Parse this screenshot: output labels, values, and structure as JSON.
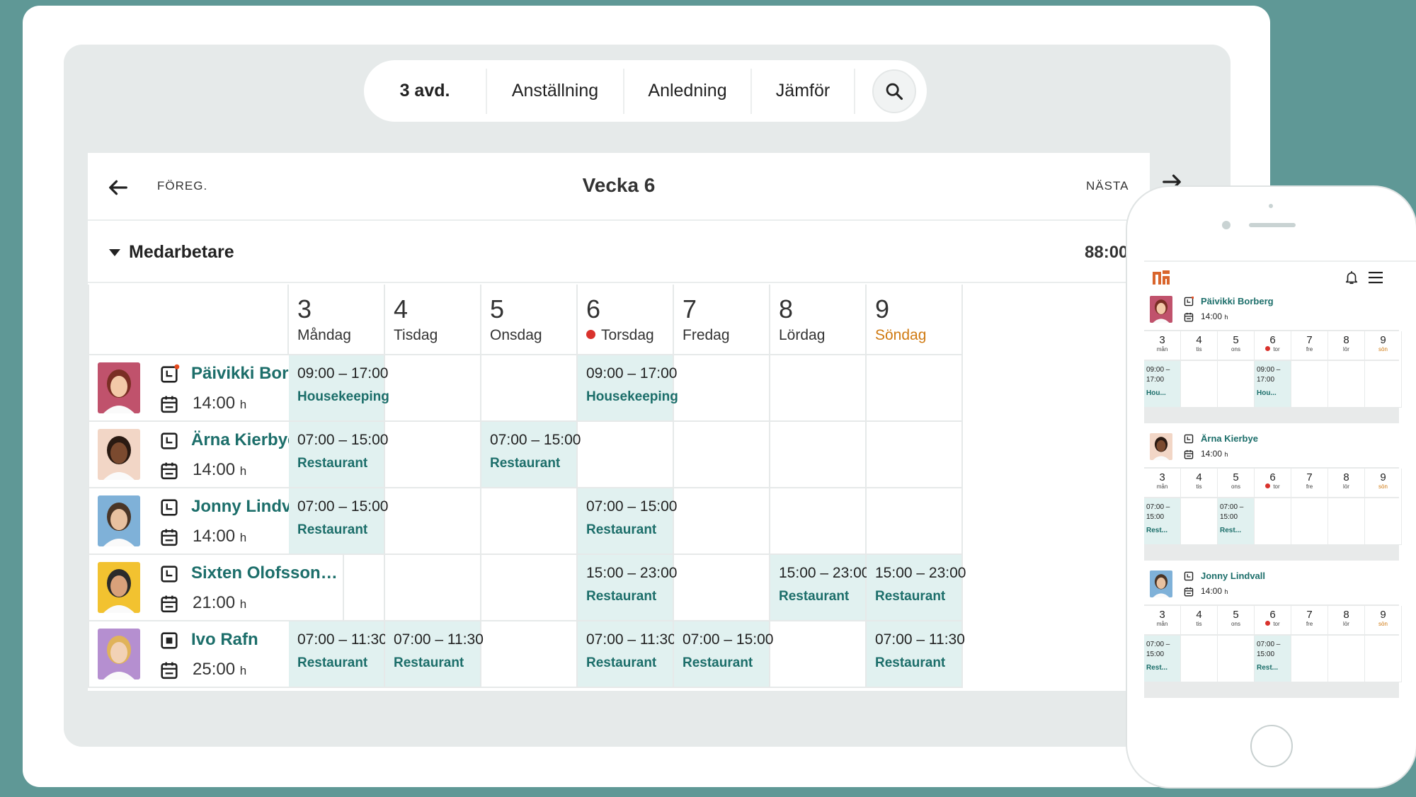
{
  "filters": [
    {
      "label": "3 avd."
    },
    {
      "label": "Anställning"
    },
    {
      "label": "Anledning"
    },
    {
      "label": "Jämför"
    }
  ],
  "week_nav": {
    "prev_label": "FÖREG.",
    "title": "Vecka 6",
    "next_label": "NÄSTA"
  },
  "section": {
    "title": "Medarbetare",
    "total": "88:00"
  },
  "days": [
    {
      "num": "3",
      "name": "Måndag"
    },
    {
      "num": "4",
      "name": "Tisdag"
    },
    {
      "num": "5",
      "name": "Onsdag"
    },
    {
      "num": "6",
      "name": "Torsdag"
    },
    {
      "num": "7",
      "name": "Fredag"
    },
    {
      "num": "8",
      "name": "Lördag"
    },
    {
      "num": "9",
      "name": "Söndag"
    }
  ],
  "hours_unit": "h",
  "employees": [
    {
      "name": "Päivikki Borberg",
      "hours": "14:00",
      "shifts": [
        {
          "time": "09:00 – 17:00",
          "place": "Housekeeping"
        },
        null,
        null,
        {
          "time": "09:00 – 17:00",
          "place": "Housekeeping"
        },
        null,
        null,
        null
      ]
    },
    {
      "name": "Ärna Kierbye",
      "hours": "14:00",
      "shifts": [
        {
          "time": "07:00 – 15:00",
          "place": "Restaurant"
        },
        null,
        {
          "time": "07:00 – 15:00",
          "place": "Restaurant"
        },
        null,
        null,
        null,
        null
      ]
    },
    {
      "name": "Jonny Lindvall",
      "hours": "14:00",
      "shifts": [
        {
          "time": "07:00 – 15:00",
          "place": "Restaurant"
        },
        null,
        null,
        {
          "time": "07:00 – 15:00",
          "place": "Restaurant"
        },
        null,
        null,
        null
      ]
    },
    {
      "name": "Sixten Olofsson L...",
      "hours": "21:00",
      "shifts": [
        null,
        null,
        null,
        {
          "time": "15:00 – 23:00",
          "place": "Restaurant"
        },
        null,
        {
          "time": "15:00 – 23:00",
          "place": "Restaurant"
        },
        {
          "time": "15:00 – 23:00",
          "place": "Restaurant"
        }
      ]
    },
    {
      "name": "Ivo Rafn",
      "hours": "25:00",
      "shifts": [
        {
          "time": "07:00 – 11:30",
          "place": "Restaurant"
        },
        {
          "time": "07:00 – 11:30",
          "place": "Restaurant"
        },
        null,
        {
          "time": "07:00 – 11:30",
          "place": "Restaurant"
        },
        {
          "time": "07:00 – 15:00",
          "place": "Restaurant"
        },
        null,
        {
          "time": "07:00 – 11:30",
          "place": "Restaurant"
        }
      ]
    }
  ],
  "mobile": {
    "days": [
      {
        "num": "3",
        "name": "mån"
      },
      {
        "num": "4",
        "name": "tis"
      },
      {
        "num": "5",
        "name": "ons"
      },
      {
        "num": "6",
        "name": "tor"
      },
      {
        "num": "7",
        "name": "fre"
      },
      {
        "num": "8",
        "name": "lör"
      },
      {
        "num": "9",
        "name": "sön"
      }
    ],
    "employees": [
      {
        "name": "Päivikki Borberg",
        "hours": "14:00",
        "shifts": [
          {
            "t1": "09:00 –",
            "t2": "17:00",
            "place": "Hou..."
          },
          null,
          null,
          {
            "t1": "09:00 –",
            "t2": "17:00",
            "place": "Hou..."
          },
          null,
          null,
          null
        ]
      },
      {
        "name": "Ärna Kierbye",
        "hours": "14:00",
        "shifts": [
          {
            "t1": "07:00 –",
            "t2": "15:00",
            "place": "Rest..."
          },
          null,
          {
            "t1": "07:00 –",
            "t2": "15:00",
            "place": "Rest..."
          },
          null,
          null,
          null,
          null
        ]
      },
      {
        "name": "Jonny Lindvall",
        "hours": "14:00",
        "shifts": [
          {
            "t1": "07:00 –",
            "t2": "15:00",
            "place": "Rest..."
          },
          null,
          null,
          {
            "t1": "07:00 –",
            "t2": "15:00",
            "place": "Rest..."
          },
          null,
          null,
          null
        ]
      }
    ]
  },
  "colors": {
    "background": "#5f9896",
    "accent": "#1c6e6a",
    "shift_bg": "#e1f1f0",
    "sunday": "#d07a12",
    "holiday_dot": "#d9322c",
    "logo": "#d9652c"
  },
  "icons": {
    "prev": "arrow-left-icon",
    "next": "arrow-right-icon",
    "search": "search-icon",
    "collapse": "caret-down-icon",
    "timesheet": "clock-sheet-icon",
    "schedule": "calendar-icon",
    "notifications": "bell-icon",
    "menu": "hamburger-menu-icon"
  }
}
